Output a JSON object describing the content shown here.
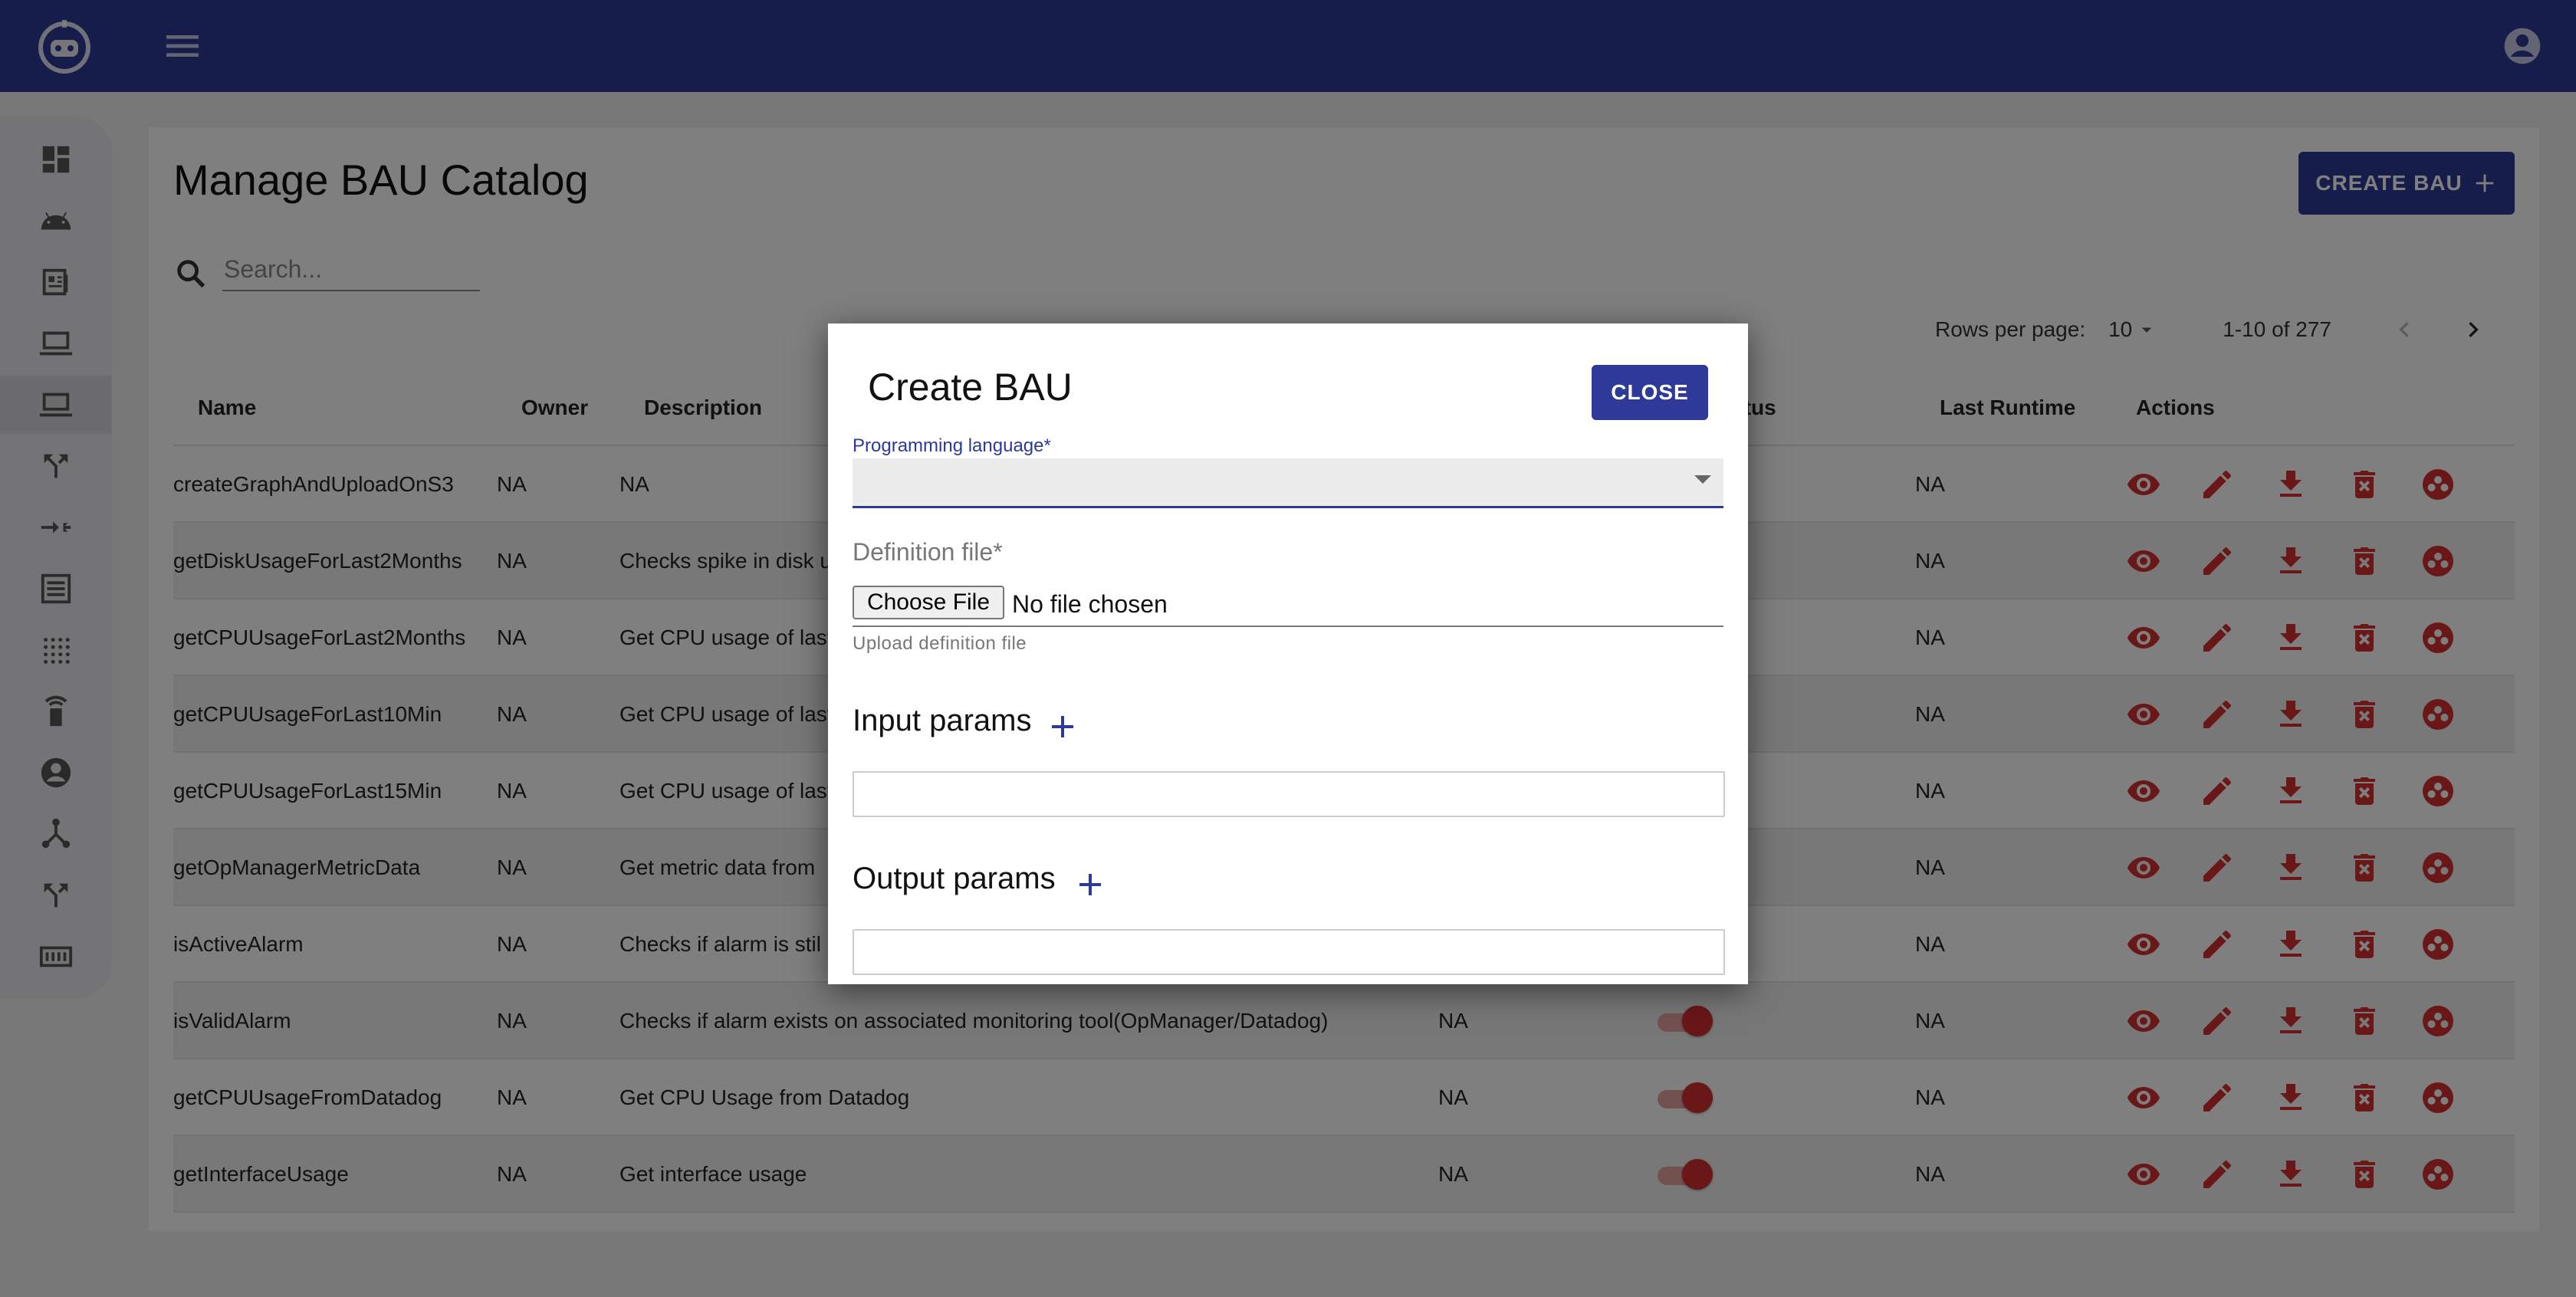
{
  "app": {
    "title": "Manage BAU Catalog"
  },
  "toolbar": {
    "create_label": "CREATE BAU"
  },
  "search": {
    "placeholder": "Search..."
  },
  "pagination": {
    "rows_per_page_label": "Rows per page:",
    "rows_per_page_value": "10",
    "range": "1-10 of 277"
  },
  "table": {
    "headers": {
      "name": "Name",
      "owner": "Owner",
      "description": "Description",
      "approval_status": "Approval Status",
      "last_runtime": "Last Runtime",
      "actions": "Actions"
    },
    "rows": [
      {
        "name": "createGraphAndUploadOnS3",
        "owner": "NA",
        "description": "NA",
        "col4": "",
        "last_runtime": "NA"
      },
      {
        "name": "getDiskUsageForLast2Months",
        "owner": "NA",
        "description": "Checks spike in disk u",
        "col4": "",
        "last_runtime": "NA"
      },
      {
        "name": "getCPUUsageForLast2Months",
        "owner": "NA",
        "description": "Get CPU usage of last",
        "col4": "",
        "last_runtime": "NA"
      },
      {
        "name": "getCPUUsageForLast10Min",
        "owner": "NA",
        "description": "Get CPU usage of last",
        "col4": "",
        "last_runtime": "NA"
      },
      {
        "name": "getCPUUsageForLast15Min",
        "owner": "NA",
        "description": "Get CPU usage of last",
        "col4": "",
        "last_runtime": "NA"
      },
      {
        "name": "getOpManagerMetricData",
        "owner": "NA",
        "description": "Get metric data from",
        "col4": "",
        "last_runtime": "NA"
      },
      {
        "name": "isActiveAlarm",
        "owner": "NA",
        "description": "Checks if alarm is stil",
        "col4": "",
        "last_runtime": "NA"
      },
      {
        "name": "isValidAlarm",
        "owner": "NA",
        "description": "Checks if alarm exists on associated monitoring tool(OpManager/Datadog)",
        "col4": "NA",
        "last_runtime": "NA"
      },
      {
        "name": "getCPUUsageFromDatadog",
        "owner": "NA",
        "description": "Get CPU Usage from Datadog",
        "col4": "NA",
        "last_runtime": "NA"
      },
      {
        "name": "getInterfaceUsage",
        "owner": "NA",
        "description": "Get interface usage",
        "col4": "NA",
        "last_runtime": "NA"
      }
    ]
  },
  "dialog": {
    "title": "Create BAU",
    "close_label": "CLOSE",
    "programming_language_label": "Programming language*",
    "programming_language_value": "",
    "definition_file_label": "Definition file*",
    "choose_file_label": "Choose File",
    "no_file_text": "No file chosen",
    "upload_helper": "Upload definition file",
    "input_params_title": "Input params",
    "output_params_title": "Output params"
  },
  "colors": {
    "primary": "#2e3a97",
    "action_icon": "#d32f2f"
  },
  "icons": {
    "sidebar": [
      "dashboard-icon",
      "android-icon",
      "article-icon",
      "laptop-icon",
      "laptop-icon",
      "call-split-icon",
      "merge-icon",
      "list-icon",
      "grid-dots-icon",
      "remote-icon",
      "account-icon",
      "hub-icon",
      "call-split-icon",
      "counter-icon"
    ],
    "row_actions": [
      "view-icon",
      "edit-icon",
      "download-icon",
      "delete-icon",
      "workspaces-icon"
    ]
  }
}
